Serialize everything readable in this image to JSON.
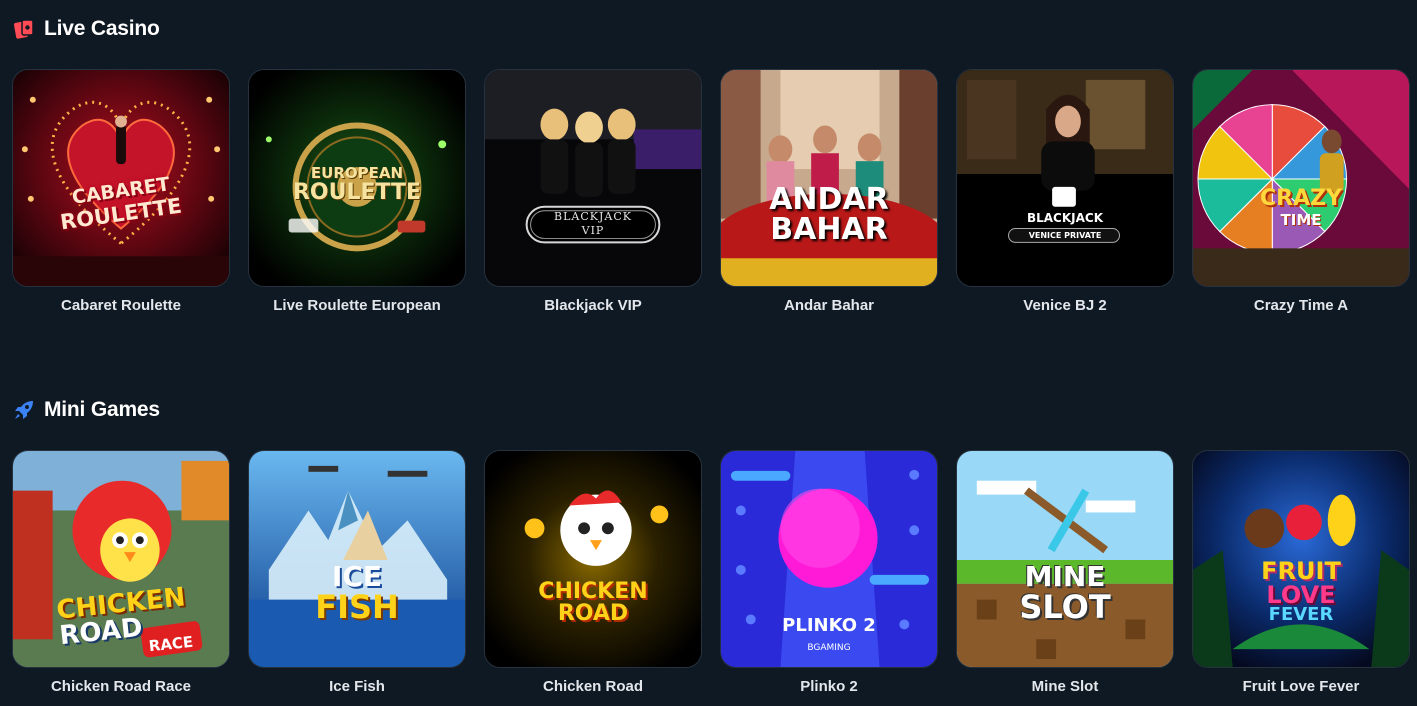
{
  "sections": {
    "live": {
      "title": "Live Casino",
      "icon": "cards-icon",
      "icon_color": "#ff4b55",
      "games": [
        {
          "name": "Cabaret Roulette",
          "logo": [
            "CABARET",
            "ROULETTE"
          ]
        },
        {
          "name": "Live Roulette European",
          "logo": [
            "EUROPEAN",
            "ROULETTE"
          ]
        },
        {
          "name": "Blackjack VIP",
          "logo": [
            "BLACKJACK",
            "VIP"
          ]
        },
        {
          "name": "Andar Bahar",
          "logo": [
            "ANDAR",
            "BAHAR"
          ]
        },
        {
          "name": "Venice BJ 2",
          "logo": [
            "BLACKJACK",
            "VENICE PRIVATE"
          ]
        },
        {
          "name": "Crazy Time A",
          "logo": [
            "CRAZY",
            "TIME"
          ]
        }
      ]
    },
    "mini": {
      "title": "Mini Games",
      "icon": "rocket-icon",
      "icon_color": "#3b82f6",
      "games": [
        {
          "name": "Chicken Road Race",
          "logo": [
            "CHICKEN",
            "ROAD",
            "RACE"
          ]
        },
        {
          "name": "Ice Fish",
          "logo": [
            "ICE",
            "FISH"
          ]
        },
        {
          "name": "Chicken Road",
          "logo": [
            "CHICKEN",
            "ROAD"
          ]
        },
        {
          "name": "Plinko 2",
          "logo": [
            "PLINKO 2",
            "BGAMING"
          ]
        },
        {
          "name": "Mine Slot",
          "logo": [
            "MINE",
            "SLOT"
          ]
        },
        {
          "name": "Fruit Love Fever",
          "logo": [
            "FRUIT",
            "LOVE",
            "FEVER"
          ]
        }
      ]
    }
  }
}
